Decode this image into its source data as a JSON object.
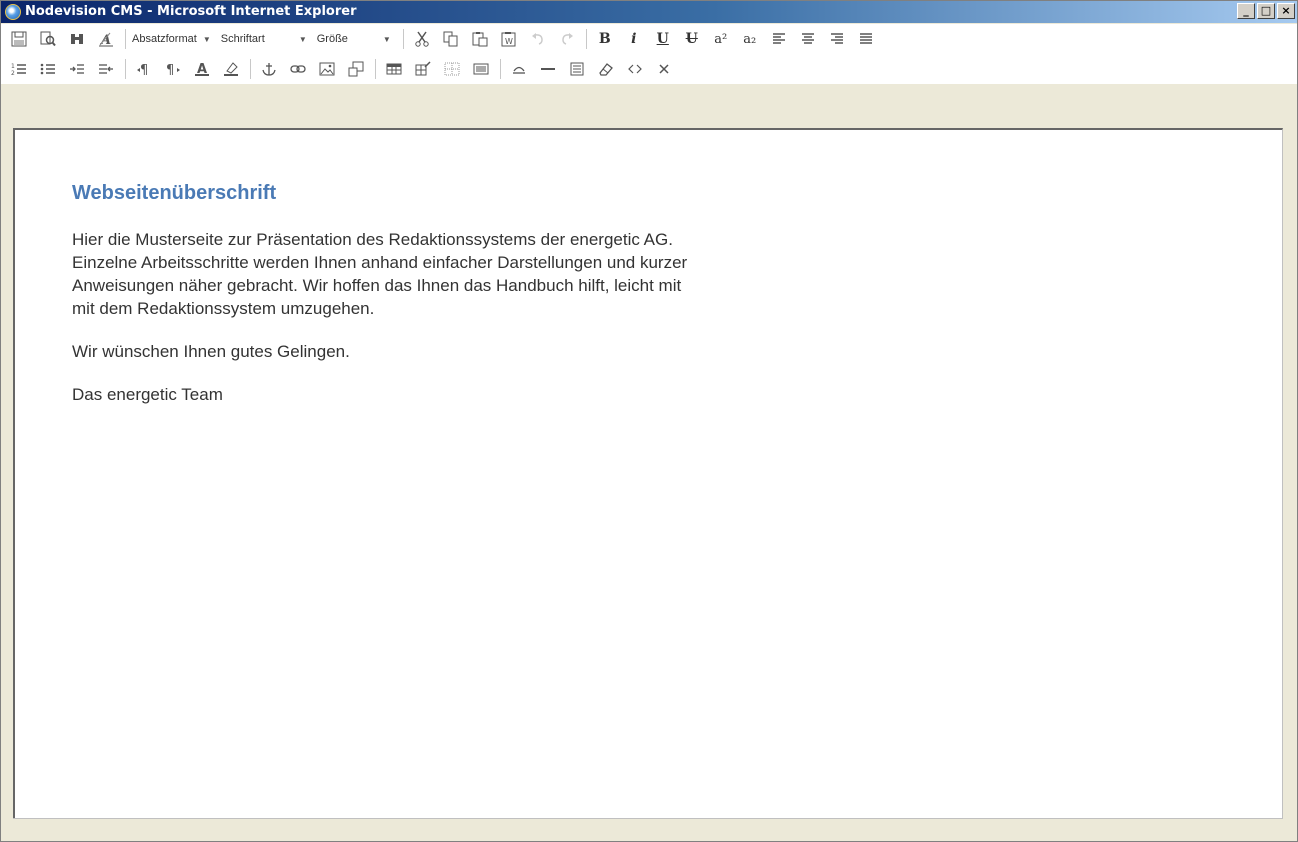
{
  "window": {
    "title": "Nodevision CMS - Microsoft Internet Explorer"
  },
  "titlebar": {
    "minimize": "_",
    "maximize": "□",
    "close": "×"
  },
  "toolbar": {
    "paragraph_format": "Absatzformat",
    "font": "Schriftart",
    "size": "Größe",
    "bold": "B",
    "italic": "i",
    "underline": "U",
    "strike": "U",
    "superscript": "a²",
    "subscript": "a₂"
  },
  "editor": {
    "heading": "Webseitenüberschrift",
    "paragraphs": [
      "Hier die Musterseite zur Präsentation des Redaktionssystems der energetic AG.\nEinzelne Arbeitsschritte werden Ihnen anhand einfacher Darstellungen und kurzer\nAnweisungen näher gebracht. Wir hoffen das Ihnen das Handbuch hilft, leicht mit\nmit dem Redaktionssystem umzugehen.",
      "Wir wünschen Ihnen gutes Gelingen.",
      "Das energetic Team"
    ]
  }
}
